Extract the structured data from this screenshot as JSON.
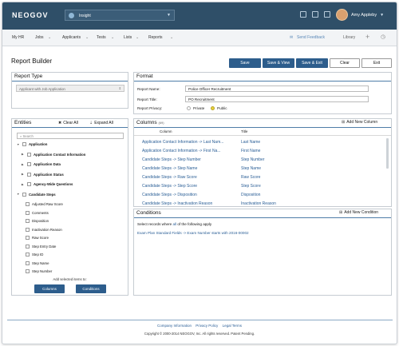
{
  "topbar": {
    "logo": "NEOGOV",
    "app_selector": "Insight",
    "user_name": "Amy Appleby"
  },
  "nav": {
    "items": [
      "My HR",
      "Jobs",
      "Applicants",
      "Tests",
      "Lists",
      "Reports"
    ],
    "send_feedback": "Send Feedback",
    "library": "Library"
  },
  "page": {
    "title": "Report Builder"
  },
  "toolbar": {
    "save": "Save",
    "save_view": "Save & View",
    "save_exit": "Save & Exit",
    "clear": "Clear",
    "exit": "Exit"
  },
  "report_type": {
    "title": "Report Type",
    "selected": "Applicant with Job Application"
  },
  "format": {
    "title": "Format",
    "report_name_label": "Report Name:",
    "report_name_value": "Police Officer Recruitment",
    "report_title_label": "Report Title:",
    "report_title_value": "PO Recruitment",
    "privacy_label": "Report Privacy:",
    "privacy_private": "Private",
    "privacy_public": "Public",
    "privacy_selected": "Public"
  },
  "entities": {
    "title": "Entities",
    "clear_all": "Clear All",
    "expand_all": "Expand All",
    "search_placeholder": "Search",
    "tree": [
      {
        "label": "Application",
        "bold": true,
        "level": 0
      },
      {
        "label": "Application Contact Information",
        "bold": true,
        "level": 1
      },
      {
        "label": "Application Data",
        "bold": true,
        "level": 1
      },
      {
        "label": "Application Status",
        "bold": true,
        "level": 1
      },
      {
        "label": "Agency-Wide Questions",
        "bold": true,
        "level": 1
      },
      {
        "label": "Candidate Steps",
        "bold": true,
        "level": 0
      },
      {
        "label": "Adjusted Raw Score",
        "bold": false,
        "level": 2
      },
      {
        "label": "Comments",
        "bold": false,
        "level": 2
      },
      {
        "label": "Disposition",
        "bold": false,
        "level": 2
      },
      {
        "label": "Inactivation Reason",
        "bold": false,
        "level": 2
      },
      {
        "label": "Raw Score",
        "bold": false,
        "level": 2
      },
      {
        "label": "Step Entry Date",
        "bold": false,
        "level": 2
      },
      {
        "label": "Step ID",
        "bold": false,
        "level": 2
      },
      {
        "label": "Step Name",
        "bold": false,
        "level": 2
      },
      {
        "label": "Step Number",
        "bold": false,
        "level": 2
      }
    ],
    "add_label": "Add selected items to:",
    "columns_btn": "Columns",
    "conditions_btn": "Conditions"
  },
  "columns": {
    "title": "Columns",
    "count": "(69)",
    "add_new": "Add New Column",
    "header_column": "Column",
    "header_title": "Title",
    "rows": [
      {
        "column": "Application Contact Information -> Last Nam...",
        "title": "Last Name"
      },
      {
        "column": "Application Contact Information -> First Na...",
        "title": "First Name"
      },
      {
        "column": "Candidate Steps -> Step Number",
        "title": "Step Number"
      },
      {
        "column": "Candidate Steps -> Step Name",
        "title": "Step Name"
      },
      {
        "column": "Candidate Steps -> Raw Score",
        "title": "Raw Score"
      },
      {
        "column": "Candidate Steps -> Step Score",
        "title": "Step Score"
      },
      {
        "column": "Candidate Steps -> Disposition",
        "title": "Disposition"
      },
      {
        "column": "Candidate Steps -> Inactivation Reason",
        "title": "Inactivation Reason"
      }
    ]
  },
  "conditions": {
    "title": "Conditions",
    "add_new": "Add New Condition",
    "select_prefix": "Select records where",
    "select_all": "all",
    "select_suffix": "of the following apply",
    "rule_field": "Exam Plan Standard Fields -> Exam Number",
    "rule_op": "starts with",
    "rule_value": "2016-00002"
  },
  "footer": {
    "links": [
      "Company Information",
      "Privacy Policy",
      "Legal Terms"
    ],
    "copyright": "Copyright © 2000-2014 NEOGOV, Inc. All rights reserved. Patent Pending."
  },
  "colors": {
    "header_bg": "#2f4f68",
    "button_blue": "#2d5d8c",
    "link": "#2a5e96"
  }
}
